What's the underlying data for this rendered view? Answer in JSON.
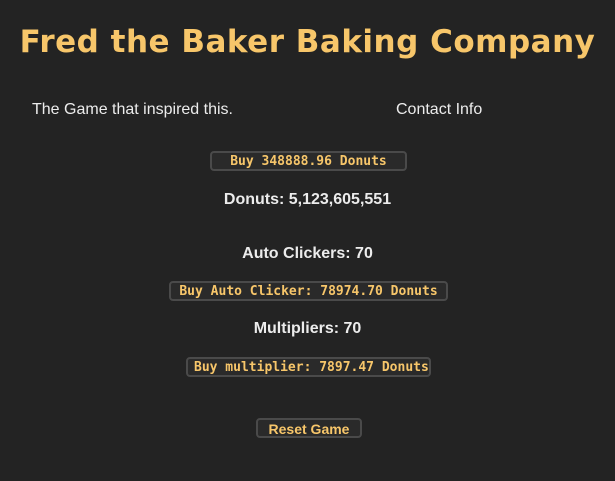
{
  "header": {
    "title": "Fred the Baker Baking Company"
  },
  "links": {
    "game_inspiration": "The Game that inspired this.",
    "contact": "Contact Info"
  },
  "buttons": {
    "buy_donuts": "Buy 348888.96 Donuts",
    "buy_auto_clicker": "Buy Auto Clicker: 78974.70 Donuts",
    "buy_multiplier": "Buy multiplier: 7897.47 Donuts",
    "reset": "Reset Game"
  },
  "stats": {
    "donuts": "Donuts: 5,123,605,551",
    "auto_clickers": "Auto Clickers: 70",
    "multipliers": "Multipliers: 70"
  },
  "colors": {
    "background": "#232323",
    "accent": "#f7c66a",
    "text": "#ececec"
  }
}
